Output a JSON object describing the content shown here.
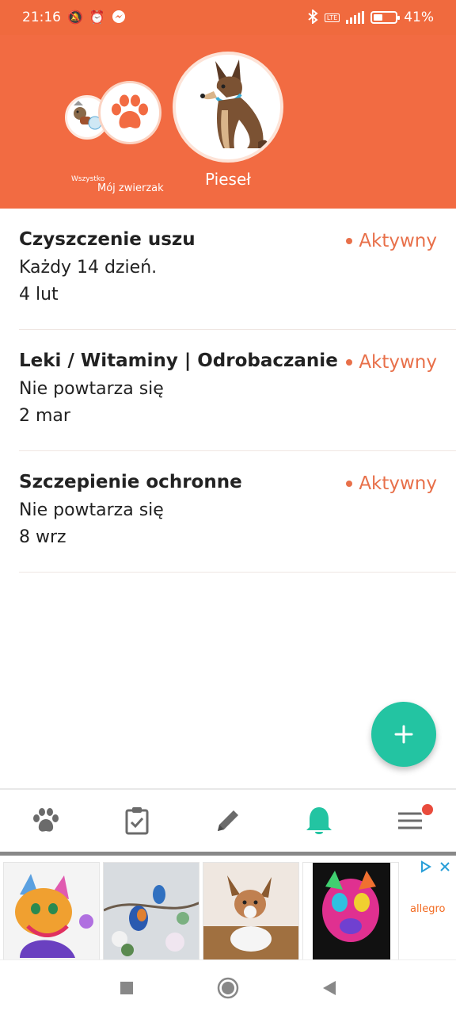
{
  "status_bar": {
    "time": "21:16",
    "battery_text": "41%",
    "battery_level": 0.41,
    "network_badge": "LTE"
  },
  "header": {
    "pets": [
      {
        "label": "Wszystko"
      },
      {
        "label": "Mój zwierzak"
      },
      {
        "label": "Pieseł"
      }
    ]
  },
  "reminders": [
    {
      "title": "Czyszczenie uszu",
      "repeat": "Każdy 14 dzień.",
      "date": "4 lut",
      "status": "Aktywny"
    },
    {
      "title": "Leki / Witaminy | Odrobaczanie",
      "repeat": "Nie powtarza się",
      "date": "2 mar",
      "status": "Aktywny"
    },
    {
      "title": "Szczepienie ochronne",
      "repeat": "Nie powtarza się",
      "date": "8 wrz",
      "status": "Aktywny"
    }
  ],
  "fab": {
    "icon": "plus-icon"
  },
  "bottom_nav": [
    {
      "icon": "paw-icon",
      "active": false
    },
    {
      "icon": "clipboard-check-icon",
      "active": false
    },
    {
      "icon": "pencil-icon",
      "active": false
    },
    {
      "icon": "bell-icon",
      "active": true
    },
    {
      "icon": "menu-icon",
      "active": false,
      "badge": true
    }
  ],
  "ad": {
    "brand": "allegro"
  },
  "colors": {
    "accent": "#f26b42",
    "status": "#e8704a",
    "fab": "#23c4a2",
    "active_nav": "#23c4a2",
    "inactive_nav": "#6b6b6b",
    "badge": "#e94b3c"
  }
}
